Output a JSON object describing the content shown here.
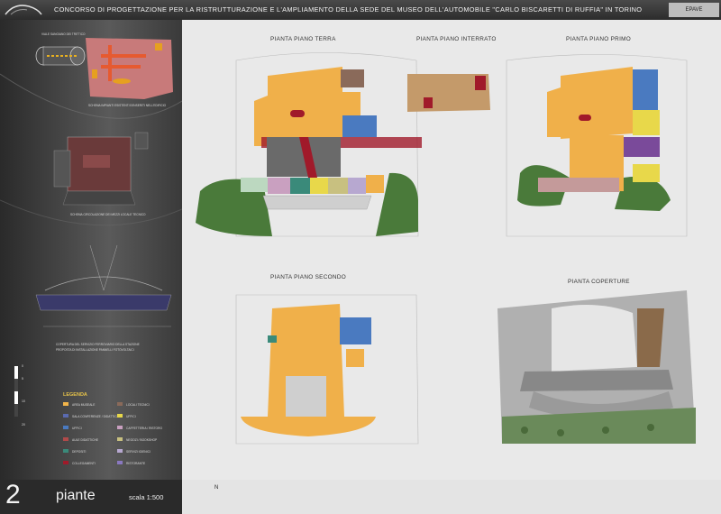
{
  "header": {
    "title": "CONCORSO  DI PROGETTAZIONE PER LA RISTRUTTURAZIONE E L'AMPLIAMENTO DELLA SEDE DEL MUSEO DELL'AUTOMOBILE \"CARLO BISCARETTI DI RUFFIA\" IN  TORINO",
    "code": "EPAVE"
  },
  "sidebar": {
    "diagram1_caption": "SCHEMA IMPIANTI ESISTENTI E/INSERITI NELL'EDIFICIO",
    "diagram1_label": "VIALE SANGIANO DEI TRITTICO",
    "diagram2_caption": "SCHEMA CIRCOLAZIONE DEI MEZZI LOCALE TECNICO",
    "diagram3_caption_1": "COPERTURA DEL SERVIZIO FERROVIARIO DELLA STAZIONE",
    "diagram3_caption_2": "PROPOSTA DI INSTALLAZIONE PANNELLI FOTOVOLTAICI",
    "scale_ticks": [
      "0",
      "5",
      "10",
      "20"
    ],
    "legend_title": "LEGENDA",
    "legend": [
      {
        "label": "AREA MUSEALE",
        "color": "#f2b54a"
      },
      {
        "label": "LOCALI TECNICI",
        "color": "#8a6a5a"
      },
      {
        "label": "SALA CONFERENZE / DIDATTICA",
        "color": "#5a6ab0"
      },
      {
        "label": "UFFICI",
        "color": "#e8d84a"
      },
      {
        "label": "UFFICI",
        "color": "#4a7ac0"
      },
      {
        "label": "CAFFETTERIA / RISTORO",
        "color": "#c9a0c0"
      },
      {
        "label": "AULE DIDATTICHE",
        "color": "#b04a4a"
      },
      {
        "label": "NEGOZI / BOOKSHOP",
        "color": "#c8c080"
      },
      {
        "label": "DEPOSITI",
        "color": "#3a8a7a"
      },
      {
        "label": "SERVIZI IGIENICI",
        "color": "#b7a8d0"
      },
      {
        "label": "COLLEGAMENTI",
        "color": "#a01a2a"
      },
      {
        "label": "RISTORANTE",
        "color": "#8a78c0"
      }
    ]
  },
  "plans": {
    "terra": "PIANTA  PIANO  TERRA",
    "interrato": "PIANTA  PIANO  INTERRATO",
    "primo": "PIANTA  PIANO  PRIMO",
    "secondo": "PIANTA  PIANO  SECONDO",
    "coperture": "PIANTA  COPERTURE"
  },
  "footer": {
    "page_number": "2",
    "page_name": "piante",
    "scale": "scala 1:500",
    "north": "N"
  }
}
